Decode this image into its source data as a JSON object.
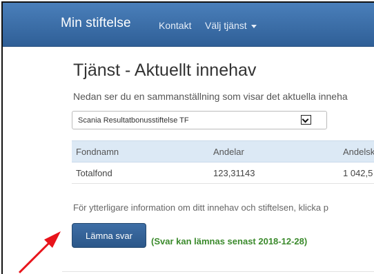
{
  "navbar": {
    "brand": "Min stiftelse",
    "links": [
      "Kontakt",
      "Välj tjänst"
    ]
  },
  "page": {
    "title": "Tjänst - Aktuellt innehav",
    "lead": "Nedan ser du en sammanställning som visar det aktuella inneha"
  },
  "foundation_select": {
    "value": "Scania Resultatbonusstiftelse TF"
  },
  "holdings_table": {
    "headers": [
      "Fondnamn",
      "Andelar",
      "Andelsk"
    ],
    "rows": [
      [
        "Totalfond",
        "123,31143",
        "1 042,5"
      ]
    ]
  },
  "info_text": "För ytterligare information om ditt innehav och stiftelsen, klicka p",
  "submit": {
    "label": "Lämna svar",
    "deadline": "(Svar kan lämnas senast 2018-12-28)"
  },
  "colors": {
    "navbar": "#3a6ca8",
    "button": "#2f5f97",
    "deadline_text": "#3b8a2c",
    "table_header": "#dce9f5",
    "annotation_arrow": "#e8141b"
  },
  "icons": [
    "caret-down-icon",
    "select-arrow-icon",
    "annotation-arrow-icon"
  ]
}
